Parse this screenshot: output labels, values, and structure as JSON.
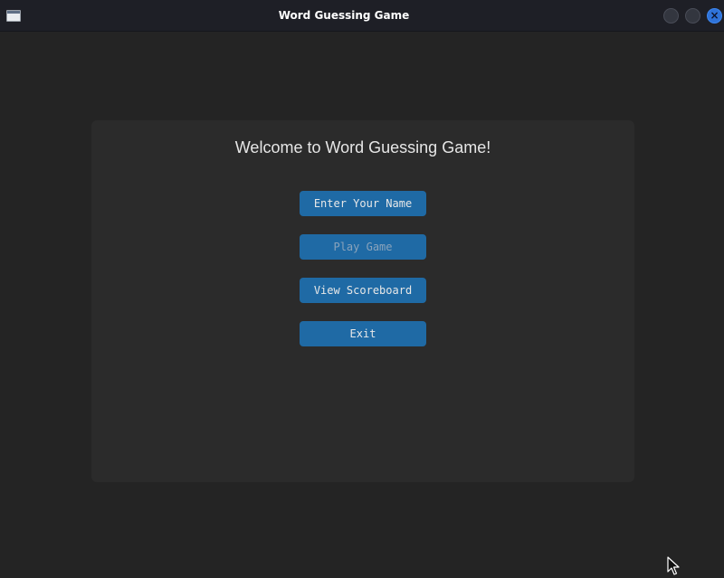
{
  "window": {
    "title": "Word Guessing Game",
    "close_glyph": "×"
  },
  "main": {
    "welcome_text": "Welcome to Word Guessing Game!",
    "buttons": [
      {
        "label": "Enter Your Name",
        "enabled": true
      },
      {
        "label": "Play Game",
        "enabled": false
      },
      {
        "label": "View Scoreboard",
        "enabled": true
      },
      {
        "label": "Exit",
        "enabled": true
      }
    ]
  },
  "colors": {
    "background": "#242424",
    "panel": "#2b2b2b",
    "button": "#1f6aa5",
    "titlebar": "#1e1f26",
    "close_button": "#2f73d9"
  },
  "icons": [
    "app-window-icon",
    "minimize-icon",
    "maximize-icon",
    "close-icon",
    "mouse-pointer-icon"
  ]
}
